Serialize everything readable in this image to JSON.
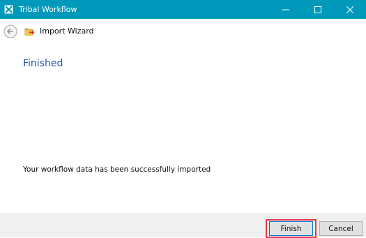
{
  "window": {
    "title": "Tribal Workflow",
    "controls": [
      "minimize-icon",
      "maximize-icon",
      "close-icon"
    ],
    "titlebar_color": "#0099bc"
  },
  "wizard": {
    "title": "Import Wizard",
    "icon": "import-wizard-icon",
    "back_icon": "back-arrow-icon"
  },
  "page": {
    "heading": "Finished",
    "message": "Your workflow data has been successfully imported"
  },
  "footer": {
    "finish_label": "Finish",
    "cancel_label": "Cancel",
    "highlight_color": "#e03a4e"
  }
}
